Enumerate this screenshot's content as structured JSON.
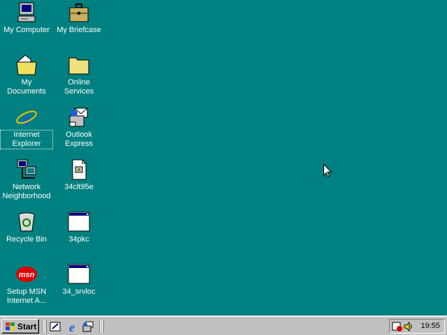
{
  "desktop_icons": [
    {
      "label": "My Computer",
      "icon": "my-computer-icon"
    },
    {
      "label": "My Briefcase",
      "icon": "briefcase-icon"
    },
    {
      "label": "My Documents",
      "icon": "my-documents-icon"
    },
    {
      "label": "Online Services",
      "icon": "folder-icon"
    },
    {
      "label": "Internet Explorer",
      "icon": "internet-explorer-icon"
    },
    {
      "label": "Outlook Express",
      "icon": "outlook-express-icon"
    },
    {
      "label": "Network Neighborhood",
      "icon": "network-neighborhood-icon"
    },
    {
      "label": "34clt95e",
      "icon": "file-icon"
    },
    {
      "label": "Recycle Bin",
      "icon": "recycle-bin-icon"
    },
    {
      "label": "34pkc",
      "icon": "program-window-icon"
    },
    {
      "label": "Setup MSN Internet A...",
      "icon": "msn-icon"
    },
    {
      "label": "34_srvloc",
      "icon": "program-window-icon"
    }
  ],
  "taskbar": {
    "start_label": "Start",
    "quick_launch": [
      "show-desktop-icon",
      "internet-explorer-icon",
      "outlook-express-icon"
    ],
    "clock": "19:55"
  },
  "colors": {
    "desktop": "#008080",
    "taskbar": "#c0c0c0"
  }
}
